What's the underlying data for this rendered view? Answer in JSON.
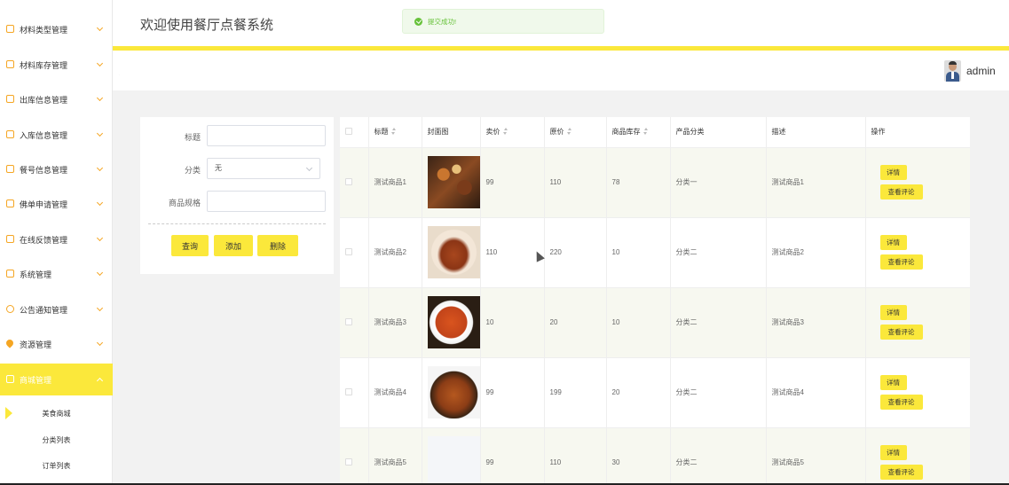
{
  "header": {
    "title": "欢迎使用餐厅点餐系统",
    "username": "admin"
  },
  "toast": {
    "message": "提交成功!"
  },
  "sidebar": {
    "items": [
      {
        "label": "材料类型管理"
      },
      {
        "label": "材料库存管理"
      },
      {
        "label": "出库信息管理"
      },
      {
        "label": "入库信息管理"
      },
      {
        "label": "餐号信息管理"
      },
      {
        "label": "佛单申请管理"
      },
      {
        "label": "在线反馈管理"
      },
      {
        "label": "系统管理"
      },
      {
        "label": "公告通知管理"
      },
      {
        "label": "资源管理"
      },
      {
        "label": "商城管理"
      }
    ],
    "sub_items": [
      {
        "label": "美食商城"
      },
      {
        "label": "分类列表"
      },
      {
        "label": "订单列表"
      }
    ]
  },
  "search": {
    "title_label": "标题",
    "category_label": "分类",
    "category_value": "无",
    "spec_label": "商品规格",
    "query_button": "查询",
    "add_button": "添加",
    "delete_button": "删除"
  },
  "table": {
    "columns": [
      "",
      "标题",
      "封面图",
      "卖价",
      "原价",
      "商品库存",
      "产品分类",
      "描述",
      "操作"
    ],
    "detail_label": "详情",
    "comment_label": "查看评论",
    "rows": [
      {
        "title": "测试商品1",
        "price": "99",
        "original": "110",
        "stock": "78",
        "category": "分类一",
        "desc": "测试商品1",
        "image": "food-spread"
      },
      {
        "title": "测试商品2",
        "price": "110",
        "original": "220",
        "stock": "10",
        "category": "分类二",
        "desc": "测试商品2",
        "image": "braised-pork"
      },
      {
        "title": "测试商品3",
        "price": "10",
        "original": "20",
        "stock": "10",
        "category": "分类二",
        "desc": "测试商品3",
        "image": "stir-fry"
      },
      {
        "title": "测试商品4",
        "price": "99",
        "original": "199",
        "stock": "20",
        "category": "分类二",
        "desc": "测试商品4",
        "image": "grilled-skewers"
      },
      {
        "title": "测试商品5",
        "price": "99",
        "original": "110",
        "stock": "30",
        "category": "分类二",
        "desc": "测试商品5",
        "image": "none"
      }
    ]
  },
  "colors": {
    "accent": "#fbe83b",
    "icon": "#f5a623",
    "success": "#67c23a"
  }
}
